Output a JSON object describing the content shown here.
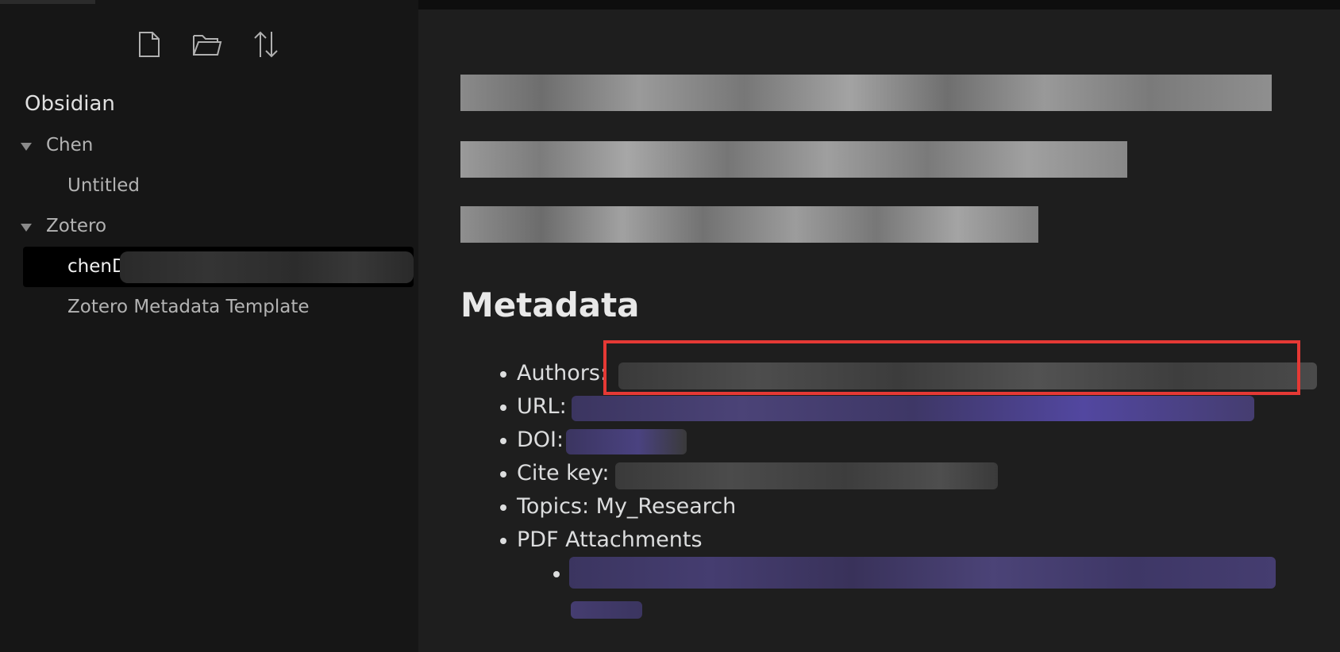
{
  "sidebar": {
    "vault_name": "Obsidian",
    "actions": [
      {
        "icon": "new-note-icon"
      },
      {
        "icon": "new-folder-icon"
      },
      {
        "icon": "sort-icon"
      }
    ],
    "folders": [
      {
        "name": "Chen",
        "expanded": true,
        "files": [
          "Untitled"
        ]
      },
      {
        "name": "Zotero",
        "expanded": true,
        "files": [
          "chenD",
          "Zotero Metadata Template"
        ]
      }
    ],
    "active_file": "chenD"
  },
  "note": {
    "heading": "Metadata",
    "items": {
      "authors": "Authors:",
      "url": "URL:",
      "doi": "DOI:",
      "cite_key": "Cite key:",
      "topics": "Topics: My_Research",
      "pdf": "PDF Attachments"
    }
  },
  "colors": {
    "sidebar_bg": "#161616",
    "editor_bg": "#1e1e1e",
    "active_bg": "#000000",
    "link": "#7f6df2",
    "highlight_box": "#e53935"
  }
}
